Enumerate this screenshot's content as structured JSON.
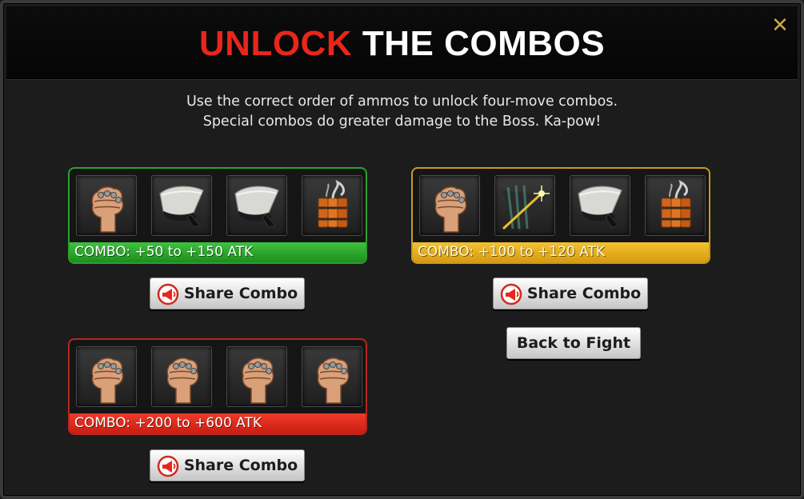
{
  "dialog": {
    "title_part1": "UNLOCK",
    "title_part2": "THE COMBOS",
    "close_glyph": "✕",
    "intro_line1": "Use the correct order of ammos to unlock four-move combos.",
    "intro_line2": "Special combos do greater damage to the Boss. Ka-pow!"
  },
  "combos": [
    {
      "color": "#2ea02e",
      "items": [
        "fist-icon",
        "blade-icon",
        "blade-icon",
        "dynamite-icon"
      ],
      "label": "COMBO: +50 to +150 ATK",
      "share_label": "Share Combo"
    },
    {
      "color": "#c99a1e",
      "items": [
        "fist-icon",
        "sparkle-blade-icon",
        "blade-icon",
        "dynamite-icon"
      ],
      "label": "COMBO: +100 to +120 ATK",
      "share_label": "Share Combo"
    },
    {
      "color": "#b8261e",
      "items": [
        "fist-icon",
        "fist-icon",
        "fist-icon",
        "fist-icon"
      ],
      "label": "COMBO: +200 to +600 ATK",
      "share_label": "Share Combo"
    }
  ],
  "back_label": "Back to Fight"
}
